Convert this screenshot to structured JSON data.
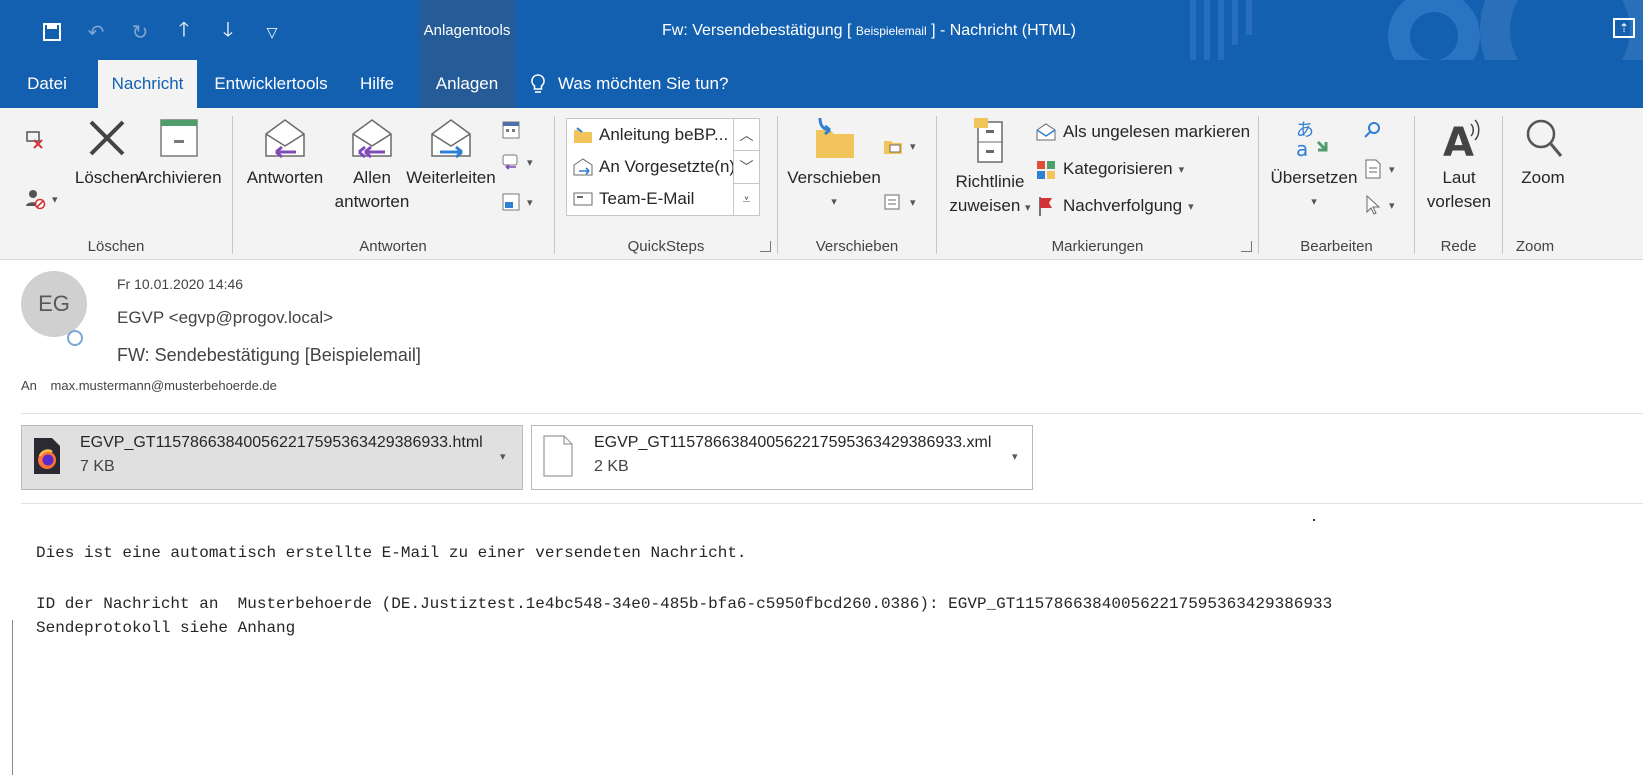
{
  "titlebar": {
    "contextual_group": "Anlagentools",
    "title_prefix": "Fw: Versendebestätigung [",
    "title_small": "Beispielemail",
    "title_suffix": "] - Nachricht (HTML)"
  },
  "tabs": {
    "datei": "Datei",
    "nachricht": "Nachricht",
    "entwicklertools": "Entwicklertools",
    "hilfe": "Hilfe",
    "anlagen": "Anlagen",
    "tell_me": "Was möchten Sie tun?"
  },
  "ribbon": {
    "loeschen": {
      "label": "Löschen",
      "delete_btn": "Löschen",
      "archive_btn": "Archivieren"
    },
    "antworten": {
      "label": "Antworten",
      "reply_btn": "Antworten",
      "reply_all_line1": "Allen",
      "reply_all_line2": "antworten",
      "forward_btn": "Weiterleiten"
    },
    "quicksteps": {
      "label": "QuickSteps",
      "items": [
        "Anleitung beBP...",
        "An Vorgesetzte(n)",
        "Team-E-Mail"
      ]
    },
    "verschieben": {
      "label": "Verschieben",
      "move_btn": "Verschieben"
    },
    "markierungen": {
      "label": "Markierungen",
      "rule_line1": "Richtlinie",
      "rule_line2": "zuweisen",
      "unread": "Als ungelesen markieren",
      "categorize": "Kategorisieren",
      "followup": "Nachverfolgung"
    },
    "bearbeiten": {
      "label": "Bearbeiten",
      "translate_btn": "Übersetzen"
    },
    "rede": {
      "label": "Rede",
      "read_line1": "Laut",
      "read_line2": "vorlesen"
    },
    "zoom": {
      "label": "Zoom",
      "zoom_btn": "Zoom"
    }
  },
  "message": {
    "avatar_initials": "EG",
    "date": "Fr 10.01.2020 14:46",
    "from": "EGVP <egvp@progov.local>",
    "subject": "FW: Sendebestätigung [Beispielemail]",
    "to_label": "An",
    "to": "max.mustermann@musterbehoerde.de"
  },
  "attachments": [
    {
      "name": "EGVP_GT1157866384005622175953634293869​33.html",
      "size": "7 KB"
    },
    {
      "name": "EGVP_GT1157866384005622175953634293869​33.xml",
      "size": "2 KB"
    }
  ],
  "body": {
    "line1": "Dies ist eine automatisch erstellte E-Mail zu einer versendeten Nachricht.",
    "line2": "ID der Nachricht an  Musterbehoerde (DE.Justiztest.1e4bc548-34e0-485b-bfa6-c5950fbcd260.0386): EGVP_GT1157866384005622175953634293869​33",
    "line3": "Sendeprotokoll siehe Anhang"
  },
  "colors": {
    "brand_blue": "#1460b0",
    "contextual_blue": "#255c97",
    "reply_purple": "#7e4bb8",
    "forward_blue": "#2f7fd3"
  }
}
